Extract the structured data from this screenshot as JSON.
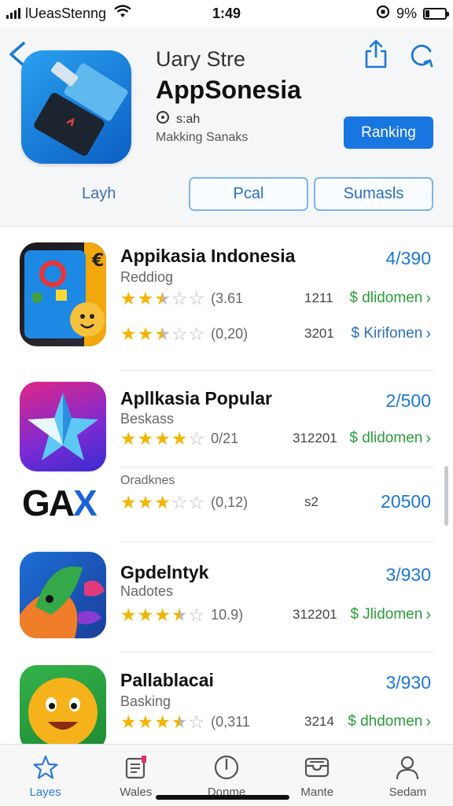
{
  "status_bar": {
    "carrier": "lUeasStenng",
    "time": "1:49",
    "battery": "9%",
    "battery_level": 0.2
  },
  "header": {
    "store_subtitle": "Uary Stre",
    "store_title": "AppSonesia",
    "meta_line1": "s:ah",
    "meta_line2": "Makking Sanaks",
    "ranking_button": "Ranking",
    "left_label": "Layh",
    "segment_1": "Pcal",
    "segment_2": "Sumasls"
  },
  "apps": [
    {
      "name": "Appikasia Indonesia",
      "subtitle": "Reddiog",
      "price": "4/390",
      "ratings": [
        {
          "stars": 2.5,
          "count": "(3.61",
          "downloads": "1211",
          "link": "$ dlidomen",
          "link_color": "green"
        },
        {
          "stars": 2.5,
          "count": "(0,20)",
          "downloads": "3201",
          "link": "$ Kirifonen",
          "link_color": "blue"
        }
      ]
    },
    {
      "name": "Apllkasia Popular",
      "subtitle": "Beskass",
      "price": "2/500",
      "ratings": [
        {
          "stars": 4,
          "count": "0/21",
          "downloads": "312201",
          "link": "$ dlidomen",
          "link_color": "green"
        }
      ]
    },
    {
      "name": "",
      "logo_text": "GAX",
      "subtitle": "Oradknes",
      "price": "20500",
      "ratings": [
        {
          "stars": 3,
          "count": "(0,12)",
          "downloads": "s2",
          "link": "",
          "link_color": "green"
        }
      ]
    },
    {
      "name": "Gpdelntyk",
      "subtitle": "Nadotes",
      "price": "3/930",
      "ratings": [
        {
          "stars": 3.5,
          "count": "10.9)",
          "downloads": "312201",
          "link": "$ Jlidomen",
          "link_color": "green"
        }
      ]
    },
    {
      "name": "Pallablacai",
      "subtitle": "Basking",
      "price": "3/930",
      "ratings": [
        {
          "stars": 3.5,
          "count": "(0,311",
          "downloads": "3214",
          "link": "$ dhdomen",
          "link_color": "green"
        }
      ]
    }
  ],
  "tabbar": {
    "tabs": [
      {
        "label": "Layes",
        "icon": "star-icon",
        "active": true
      },
      {
        "label": "Wales",
        "icon": "list-icon",
        "active": false
      },
      {
        "label": "Donme",
        "icon": "compass-icon",
        "active": false
      },
      {
        "label": "Mante",
        "icon": "tray-icon",
        "active": false
      },
      {
        "label": "Sedam",
        "icon": "person-icon",
        "active": false
      }
    ]
  },
  "colors": {
    "accent": "#1876e0",
    "price": "#1c78d6",
    "download_green": "#2a9d3a",
    "star": "#f4b400"
  }
}
